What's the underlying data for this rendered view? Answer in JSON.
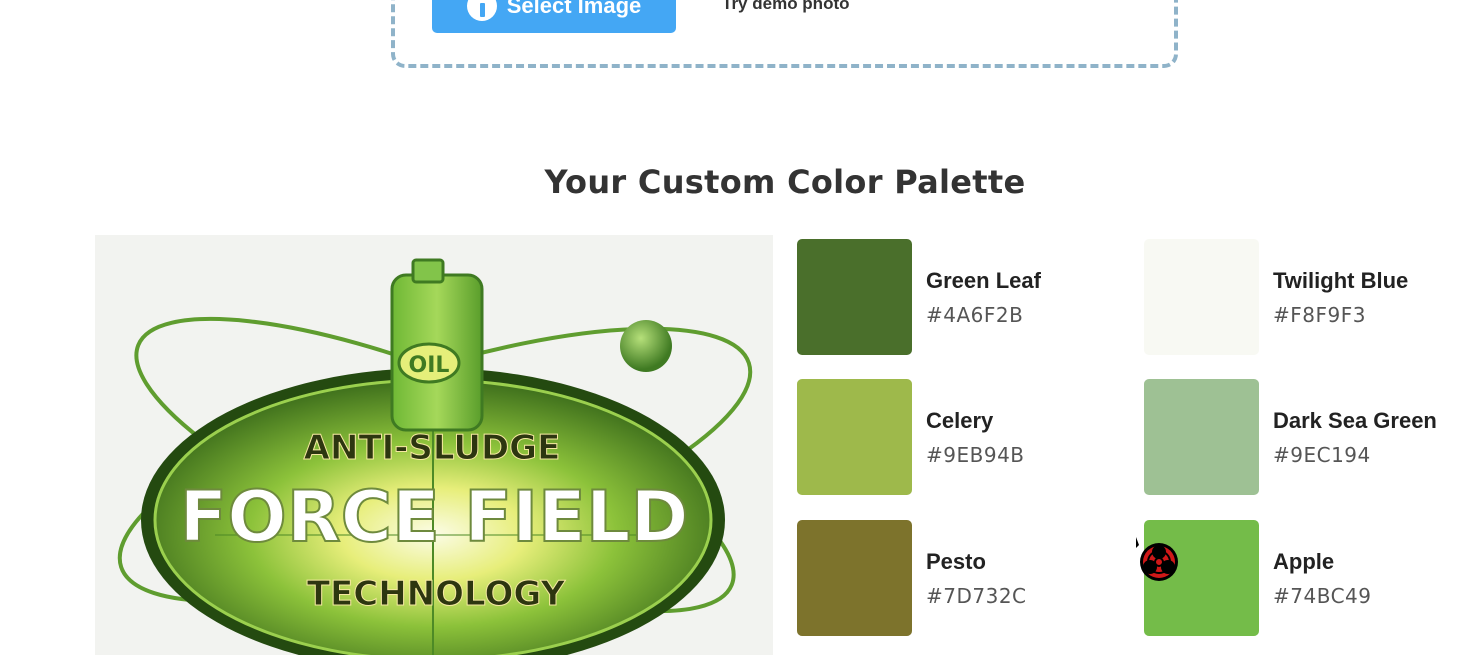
{
  "upload": {
    "select_label": "Select Image",
    "demo_label": "Try demo photo"
  },
  "palette": {
    "title": "Your Custom Color Palette",
    "colors": [
      {
        "name": "Green Leaf",
        "hex": "#4A6F2B"
      },
      {
        "name": "Twilight Blue",
        "hex": "#F8F9F3"
      },
      {
        "name": "Celery",
        "hex": "#9EB94B"
      },
      {
        "name": "Dark Sea Green",
        "hex": "#9EC194"
      },
      {
        "name": "Pesto",
        "hex": "#7D732C"
      },
      {
        "name": "Apple",
        "hex": "#74BC49"
      }
    ]
  },
  "photo": {
    "label_oil": "OIL",
    "label_top": "ANTI-SLUDGE",
    "label_main": "FORCE FIELD",
    "label_bottom": "TECHNOLOGY"
  },
  "icons": {
    "button_icon": "info-icon",
    "cursor_icon": "biohazard-cursor-icon"
  }
}
